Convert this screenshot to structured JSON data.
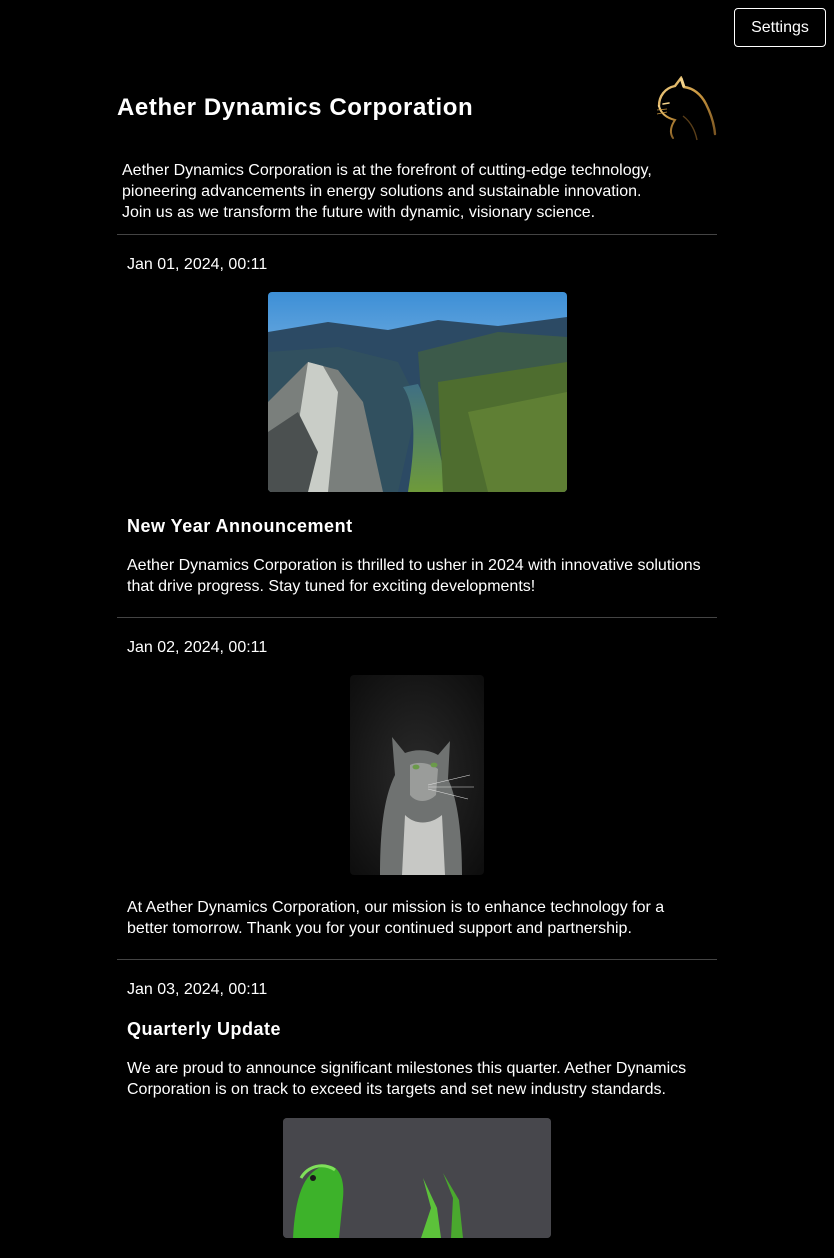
{
  "header": {
    "settings_label": "Settings",
    "site_title": "Aether Dynamics Corporation",
    "logo_icon": "cat-logo-icon",
    "intro": "Aether Dynamics Corporation is at the forefront of cutting-edge technology, pioneering advancements in energy solutions and sustainable innovation. Join us as we transform the future with dynamic, visionary science."
  },
  "posts": [
    {
      "date": "Jan 01, 2024, 00:11",
      "image": "mountain-fjord-photo",
      "title": "New Year Announcement",
      "body": "Aether Dynamics Corporation is thrilled to usher in 2024 with innovative solutions that drive progress. Stay tuned for exciting developments!"
    },
    {
      "date": "Jan 02, 2024, 00:11",
      "image": "gray-cat-photo",
      "body": "At Aether Dynamics Corporation, our mission is to enhance technology for a better tomorrow. Thank you for your continued support and partnership."
    },
    {
      "date": "Jan 03, 2024, 00:11",
      "title": "Quarterly Update",
      "body": "We are proud to announce significant milestones this quarter. Aether Dynamics Corporation is on track to exceed its targets and set new industry standards.",
      "image": "green-gecko-photo"
    }
  ]
}
